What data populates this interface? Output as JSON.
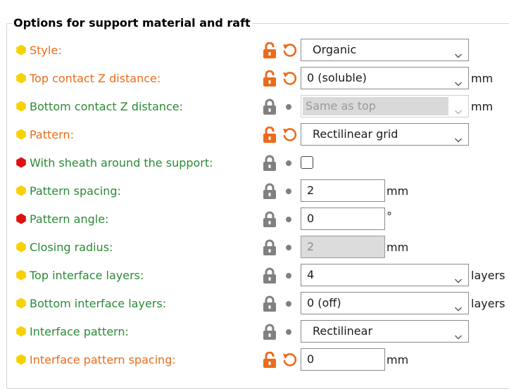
{
  "group_title": "Options for support material and raft",
  "colors": {
    "modified_label": "#ec6b1b",
    "system_label": "#2b8a36",
    "bullet_yellow": "#f7d200",
    "bullet_red": "#e01010",
    "unlocked": "#ec6b1b",
    "locked": "#808080"
  },
  "rows": [
    {
      "label": "Style:",
      "state": "modified",
      "bullet": "yellow",
      "control": "combo",
      "value": "Organic",
      "unit": ""
    },
    {
      "label": "Top contact Z distance:",
      "state": "modified",
      "bullet": "yellow",
      "control": "edit-combo",
      "value": "0 (soluble)",
      "unit": "mm"
    },
    {
      "label": "Bottom contact Z distance:",
      "state": "system",
      "bullet": "yellow",
      "control": "edit-combo-disabled",
      "value": "Same as top",
      "unit": "mm"
    },
    {
      "label": "Pattern:",
      "state": "modified",
      "bullet": "yellow",
      "control": "combo",
      "value": "Rectilinear grid",
      "unit": ""
    },
    {
      "label": "With sheath around the support:",
      "state": "system",
      "bullet": "red",
      "control": "checkbox",
      "value": "",
      "unit": "",
      "checked": false
    },
    {
      "label": "Pattern spacing:",
      "state": "system",
      "bullet": "yellow",
      "control": "text",
      "value": "2",
      "unit": "mm"
    },
    {
      "label": "Pattern angle:",
      "state": "system",
      "bullet": "red",
      "control": "text",
      "value": "0",
      "unit": "°"
    },
    {
      "label": "Closing radius:",
      "state": "system",
      "bullet": "yellow",
      "control": "text-disabled",
      "value": "2",
      "unit": "mm"
    },
    {
      "label": "Top interface layers:",
      "state": "system",
      "bullet": "yellow",
      "control": "edit-combo",
      "value": "4",
      "unit": "layers"
    },
    {
      "label": "Bottom interface layers:",
      "state": "system",
      "bullet": "yellow",
      "control": "edit-combo",
      "value": "0 (off)",
      "unit": "layers"
    },
    {
      "label": "Interface pattern:",
      "state": "system",
      "bullet": "yellow",
      "control": "combo",
      "value": "Rectilinear",
      "unit": ""
    },
    {
      "label": "Interface pattern spacing:",
      "state": "modified",
      "bullet": "yellow",
      "control": "text",
      "value": "0",
      "unit": "mm"
    }
  ]
}
